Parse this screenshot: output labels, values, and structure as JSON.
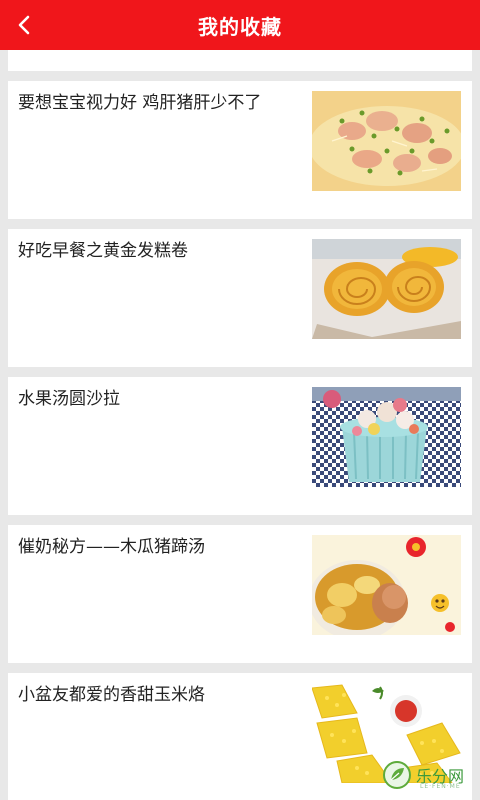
{
  "header": {
    "title": "我的收藏",
    "back_icon": "chevron-left-icon",
    "background_color": "#f0161b"
  },
  "favorites": [
    {
      "title": "要想宝宝视力好 鸡肝猪肝少不了",
      "image": "liver-dish-photo"
    },
    {
      "title": "好吃早餐之黄金发糕卷",
      "image": "sponge-cake-roll-photo"
    },
    {
      "title": "水果汤圆沙拉",
      "image": "fruit-tangyuan-salad-photo"
    },
    {
      "title": "催奶秘方——木瓜猪蹄汤",
      "image": "papaya-pig-trotter-soup-photo"
    },
    {
      "title": "小盆友都爱的香甜玉米烙",
      "image": "corn-pancake-photo"
    }
  ],
  "watermark": {
    "text": "乐分网",
    "sub": "LE·FEN·ME"
  }
}
